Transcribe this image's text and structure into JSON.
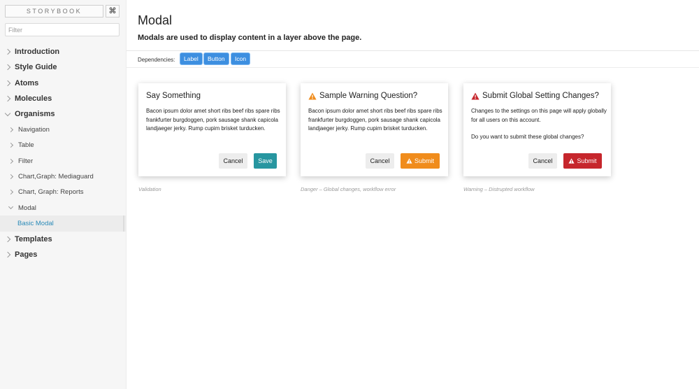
{
  "sidebar": {
    "brand": "STORYBOOK",
    "shortcut_icon": "command-icon",
    "shortcut_label": "⌘",
    "filter_placeholder": "Filter",
    "items": [
      {
        "label": "Introduction",
        "level": 0,
        "expanded": false
      },
      {
        "label": "Style Guide",
        "level": 0,
        "expanded": false
      },
      {
        "label": "Atoms",
        "level": 0,
        "expanded": false
      },
      {
        "label": "Molecules",
        "level": 0,
        "expanded": false
      },
      {
        "label": "Organisms",
        "level": 0,
        "expanded": true
      },
      {
        "label": "Navigation",
        "level": 1,
        "expanded": false
      },
      {
        "label": "Table",
        "level": 1,
        "expanded": false
      },
      {
        "label": "Filter",
        "level": 1,
        "expanded": false
      },
      {
        "label": "Chart,Graph: Mediaguard",
        "level": 1,
        "expanded": false
      },
      {
        "label": "Chart, Graph: Reports",
        "level": 1,
        "expanded": false
      },
      {
        "label": "Modal",
        "level": 1,
        "expanded": true
      },
      {
        "label": "Basic Modal",
        "level": 2,
        "selected": true
      },
      {
        "label": "Templates",
        "level": 0,
        "expanded": false
      },
      {
        "label": "Pages",
        "level": 0,
        "expanded": false
      }
    ]
  },
  "header": {
    "title": "Modal",
    "subtitle": "Modals are used to display content in a layer above the page."
  },
  "dependencies": {
    "label": "Dependencies:",
    "items": [
      "Label",
      "Button",
      "Icon"
    ],
    "color": "#3d8fe0"
  },
  "modals": [
    {
      "title": "Say Something",
      "icon": null,
      "body": [
        "Bacon ipsum dolor amet short ribs beef ribs spare ribs frankfurter burgdoggen, pork sausage shank capicola landjaeger jerky. Rump cupim brisket turducken."
      ],
      "cancel_label": "Cancel",
      "primary_label": "Save",
      "primary_color": "#2796a0",
      "caption": "Validation"
    },
    {
      "title": "Sample Warning Question?",
      "icon": "warning-icon",
      "icon_color": "#f08c1c",
      "body": [
        "Bacon ipsum dolor amet short ribs beef ribs spare ribs frankfurter burgdoggen, pork sausage shank capicola landjaeger jerky. Rump cupim brisket turducken."
      ],
      "cancel_label": "Cancel",
      "primary_label": "Submit",
      "primary_color": "#f08c1c",
      "caption": "Danger – Global changes, workflow error"
    },
    {
      "title": "Submit Global Setting Changes?",
      "icon": "warning-icon",
      "icon_color": "#c6262c",
      "body": [
        "Changes to the settings on this page will apply globally for all users on this account.",
        "Do you want to submit these global changes?"
      ],
      "cancel_label": "Cancel",
      "primary_label": "Submit",
      "primary_color": "#c6262c",
      "caption": "Warning – Distrupted workflow"
    }
  ]
}
